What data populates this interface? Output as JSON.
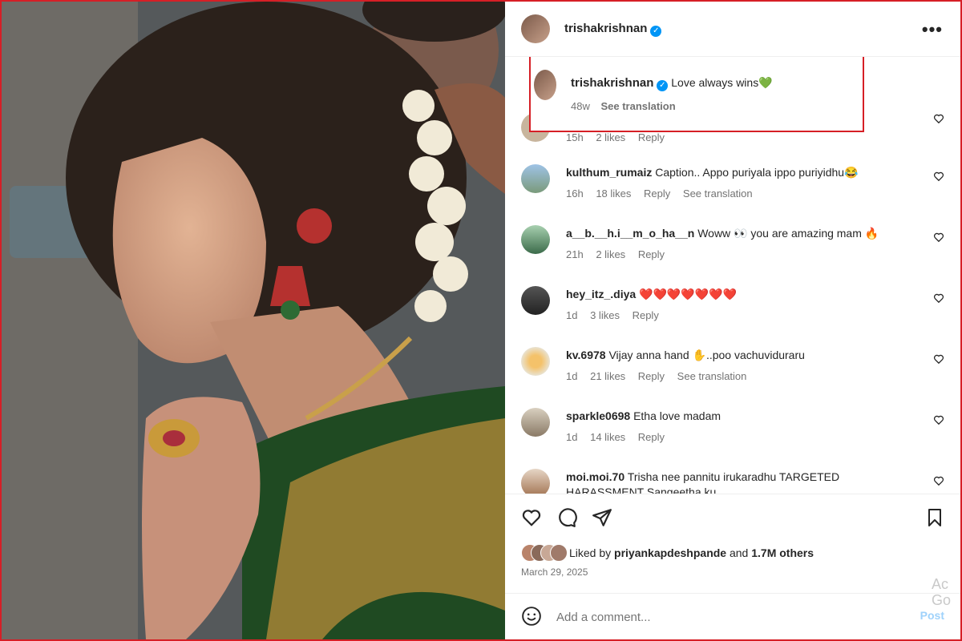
{
  "post": {
    "author": "trishakrishnan",
    "caption_text": "Love always wins",
    "caption_emoji": "💚",
    "caption_age": "48w",
    "caption_translate": "See translation"
  },
  "comments": [
    {
      "user": "",
      "text": "",
      "age": "15h",
      "likes": "2 likes",
      "reply": "Reply",
      "translate": ""
    },
    {
      "user": "kulthum_rumaiz",
      "text": "Caption.. Appo puriyala ippo puriyidhu😂",
      "age": "16h",
      "likes": "18 likes",
      "reply": "Reply",
      "translate": "See translation"
    },
    {
      "user": "a__b.__h.i__m_o_ha__n",
      "text": "Woww 👀 you are amazing mam 🔥",
      "age": "21h",
      "likes": "2 likes",
      "reply": "Reply",
      "translate": ""
    },
    {
      "user": "hey_itz_.diya",
      "text": "❤️❤️❤️❤️❤️❤️❤️",
      "age": "1d",
      "likes": "3 likes",
      "reply": "Reply",
      "translate": ""
    },
    {
      "user": "kv.6978",
      "text": "Vijay anna hand ✋..poo vachuviduraru",
      "age": "1d",
      "likes": "21 likes",
      "reply": "Reply",
      "translate": "See translation"
    },
    {
      "user": "sparkle0698",
      "text": "Etha love madam",
      "age": "1d",
      "likes": "14 likes",
      "reply": "Reply",
      "translate": ""
    },
    {
      "user": "moi.moi.70",
      "text": "Trisha nee pannitu irukaradhu TARGETED HARASSMENT Sangeetha ku",
      "age": "",
      "likes": "",
      "reply": "",
      "translate": ""
    }
  ],
  "likes": {
    "prefix": "Liked by",
    "user": "priyankapdeshpande",
    "and": "and",
    "count": "1.7M others"
  },
  "date": "March 29, 2025",
  "add_comment": {
    "placeholder": "Add a comment...",
    "post": "Post"
  },
  "watermark": "Ac Go",
  "colors": {
    "accent": "#0095f6",
    "highlight": "#d61f26"
  }
}
